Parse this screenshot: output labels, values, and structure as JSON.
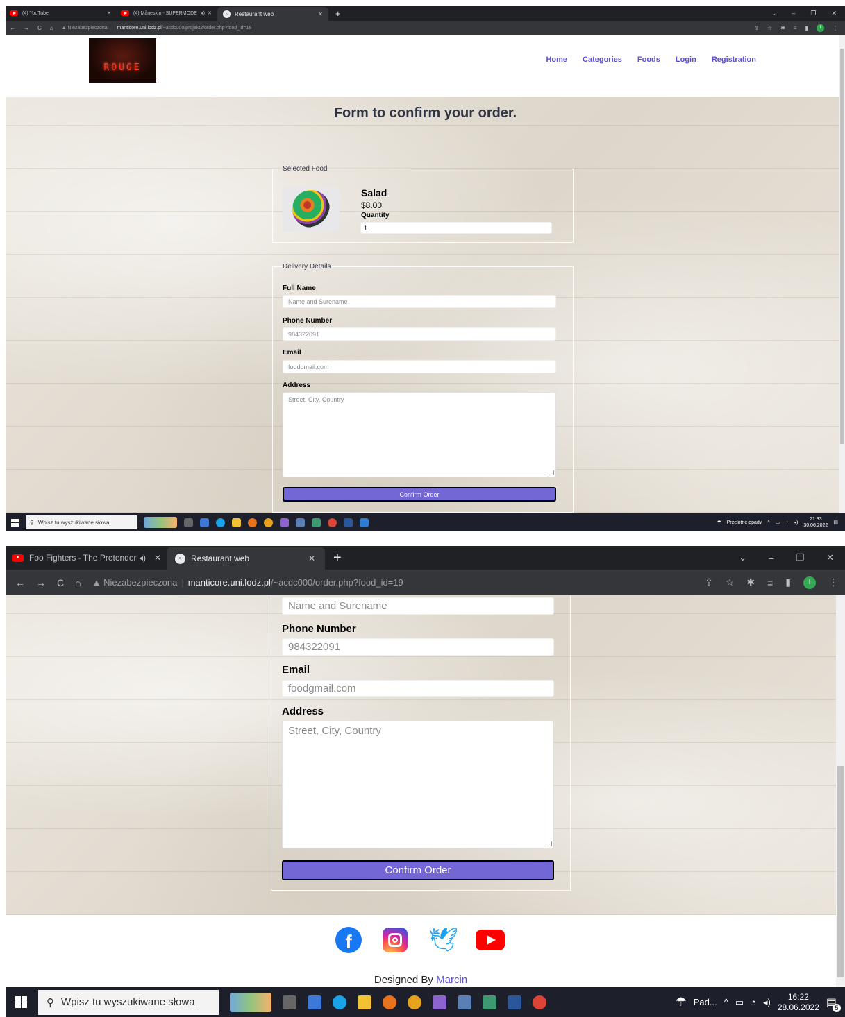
{
  "screenshot1": {
    "tabs": [
      {
        "label": "(4) YouTube",
        "icon": "youtube-icon"
      },
      {
        "label": "(4) Måneskin - SUPERMODE",
        "icon": "youtube-icon",
        "audio": "◂)"
      },
      {
        "label": "Restaurant web",
        "icon": "globe-icon"
      }
    ],
    "url": {
      "warning": "Niezabezpieczona",
      "domain": "manticore.uni.lodz.pl",
      "path": "/~acdc000/projekt2/order.php?food_id=19"
    },
    "nav": [
      "Home",
      "Categories",
      "Foods",
      "Login",
      "Registration"
    ],
    "logo_text": "ROUGE",
    "page_title": "Form to confirm your order.",
    "selected_food": {
      "legend": "Selected Food",
      "name": "Salad",
      "price": "$8.00",
      "quantity_label": "Quantity",
      "quantity_value": "1"
    },
    "delivery": {
      "legend": "Delivery Details",
      "full_name_label": "Full Name",
      "full_name_placeholder": "Name and Surename",
      "phone_label": "Phone Number",
      "phone_value": "984322091",
      "email_label": "Email",
      "email_value": "foodgmail.com",
      "address_label": "Address",
      "address_placeholder": "Street, City, Country",
      "confirm_label": "Confirm Order"
    },
    "taskbar": {
      "search_placeholder": "Wpisz tu wyszukiwane słowa",
      "weather": "Przelotne opady",
      "time": "21:33",
      "date": "30.06.2022"
    }
  },
  "screenshot2": {
    "tabs": [
      {
        "label": "Foo Fighters - The Pretender",
        "icon": "youtube-icon",
        "audio": "◂)"
      },
      {
        "label": "Restaurant web",
        "icon": "globe-icon"
      }
    ],
    "url": {
      "warning": "Niezabezpieczona",
      "domain": "manticore.uni.lodz.pl",
      "path": "/~acdc000/order.php?food_id=19"
    },
    "delivery": {
      "full_name_placeholder": "Name and Surename",
      "phone_label": "Phone Number",
      "phone_value": "984322091",
      "email_label": "Email",
      "email_value": "foodgmail.com",
      "address_label": "Address",
      "address_placeholder": "Street, City, Country",
      "confirm_label": "Confirm Order"
    },
    "footer": {
      "designed_by": "Designed By",
      "author": "Marcin"
    },
    "taskbar": {
      "search_placeholder": "Wpisz tu wyszukiwane słowa",
      "weather": "Pad...",
      "time": "16:22",
      "date": "28.06.2022",
      "notifications": "5"
    }
  },
  "colors": {
    "accent": "#5b4fd1",
    "button": "#7267d4",
    "chrome": "#202124"
  }
}
